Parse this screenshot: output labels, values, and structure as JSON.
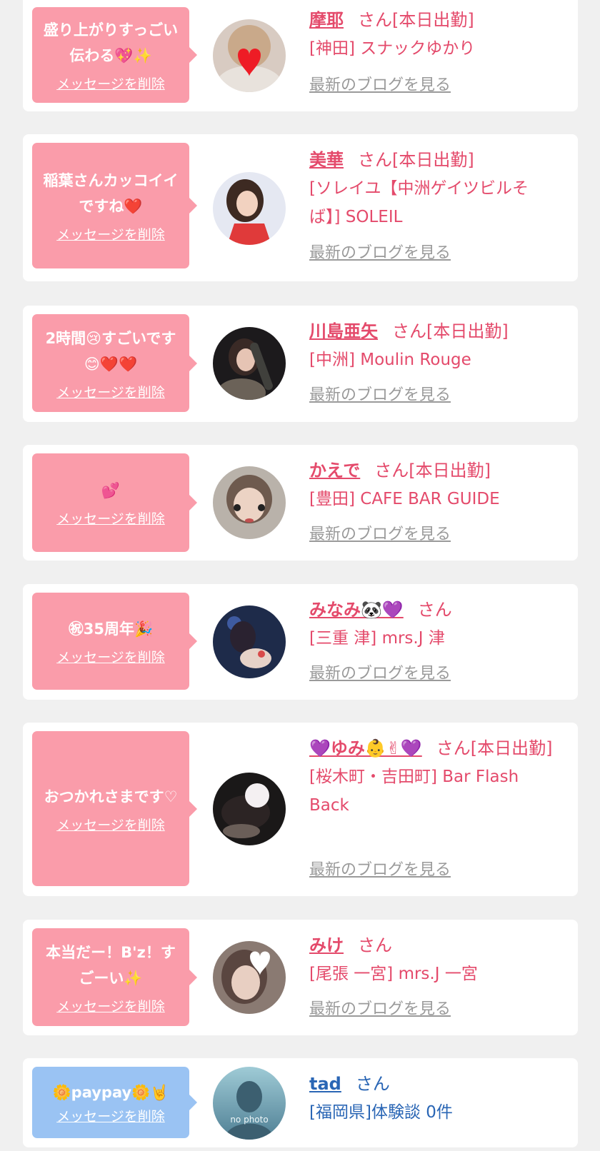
{
  "messages": [
    {
      "message": "盛り上がりすっごい伝わる💖✨",
      "delete_label": "メッセージを削除",
      "cast_name": "摩耶",
      "suffix": "さん[本日出勤]",
      "shop": "[神田] スナックゆかり",
      "blog_label": "最新のブログを見る"
    },
    {
      "message": "稲葉さんカッコイイですね❤️",
      "delete_label": "メッセージを削除",
      "cast_name": "美華",
      "suffix": "さん[本日出勤]",
      "shop": "[ソレイユ【中洲ゲイツビルそば】] SOLEIL",
      "blog_label": "最新のブログを見る"
    },
    {
      "message": "2時間😢すごいです😊❤️❤️",
      "delete_label": "メッセージを削除",
      "cast_name": "川島亜矢",
      "suffix": "さん[本日出勤]",
      "shop": "[中洲] Moulin Rouge",
      "blog_label": "最新のブログを見る"
    },
    {
      "message": "💕",
      "delete_label": "メッセージを削除",
      "cast_name": "かえで",
      "suffix": "さん[本日出勤]",
      "shop": "[豊田] CAFE BAR GUIDE",
      "blog_label": "最新のブログを見る"
    },
    {
      "message": "㊗35周年🎉",
      "delete_label": "メッセージを削除",
      "cast_name": "みなみ🐼💜",
      "suffix": "さん",
      "shop": "[三重 津] mrs.J 津",
      "blog_label": "最新のブログを見る"
    },
    {
      "message": "おつかれさまです♡",
      "delete_label": "メッセージを削除",
      "cast_name": "💜ゆみ👶✌💜",
      "suffix": "さん[本日出勤]",
      "shop": "[桜木町・吉田町] Bar Flash Back",
      "blog_label": "最新のブログを見る"
    },
    {
      "message": "本当だー！B'z！すごーい✨",
      "delete_label": "メッセージを削除",
      "cast_name": "みけ",
      "suffix": "さん",
      "shop": "[尾張 一宮] mrs.J 一宮",
      "blog_label": "最新のブログを見る"
    },
    {
      "message": "🌼paypay🌼🤘",
      "delete_label": "メッセージを削除",
      "cast_name": "tad",
      "suffix": "さん",
      "shop": "[福岡県]体験談 0件",
      "avatar_text": "no photo"
    }
  ],
  "colors": {
    "page_bg": "#f0f0f0",
    "bubble_pink": "#fa9caa",
    "bubble_blue": "#9ac3f3",
    "cast_text": "#e44a6b",
    "user_name": "#2a66b5",
    "blog_link": "#9a9a9a"
  }
}
